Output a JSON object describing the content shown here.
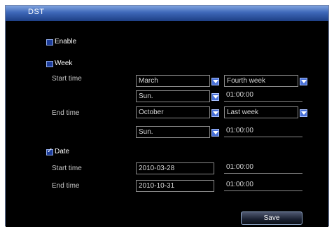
{
  "window": {
    "title": "DST"
  },
  "enable": {
    "label": "Enable",
    "checked": true
  },
  "week_mode": {
    "label": "Week",
    "checked": true,
    "start_label": "Start time",
    "end_label": "End time",
    "start_month": "March",
    "start_week": "Fourth week",
    "start_day": "Sun.",
    "start_time": "01:00:00",
    "end_month": "October",
    "end_week": "Last week",
    "end_day": "Sun.",
    "end_time": "01:00:00"
  },
  "date_mode": {
    "label": "Date",
    "checked": true,
    "start_label": "Start time",
    "end_label": "End time",
    "start_date": "2010-03-28",
    "start_time": "01:00:00",
    "end_date": "2010-10-31",
    "end_time": "01:00:00"
  },
  "buttons": {
    "save": "Save"
  },
  "colors": {
    "title_bar": "#3d67b8",
    "checkbox": "#1d3d9a",
    "dropdown": "#4870d6"
  }
}
